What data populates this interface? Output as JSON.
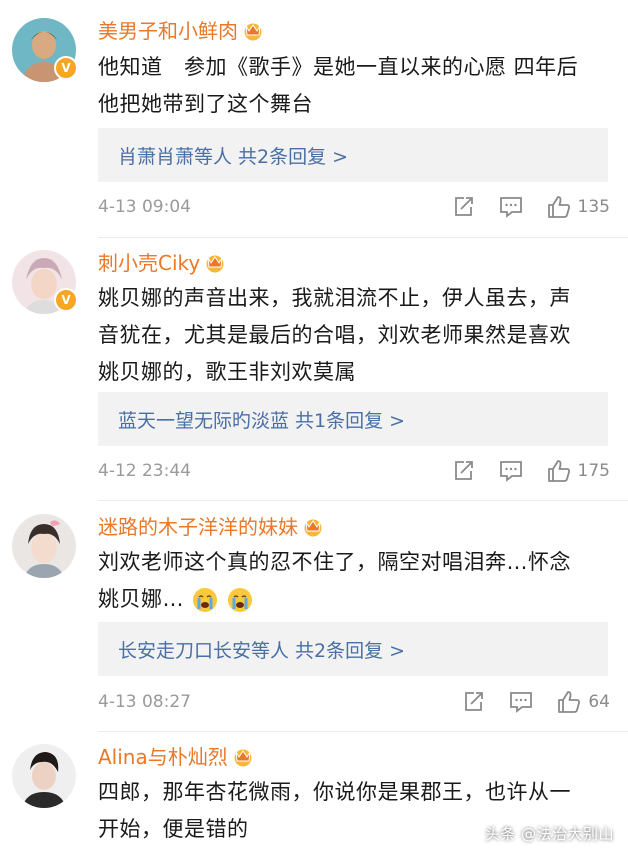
{
  "comments": [
    {
      "username": "美男子和小鲜肉",
      "text_lines": [
        "他知道　参加《歌手》是她一直以来的心愿 四年后",
        "他把她带到了这个舞台"
      ],
      "reply_names": "肖萧肖萧等人",
      "reply_count": "共2条回复 >",
      "time": "4-13 09:04",
      "likes": "135",
      "verified": true
    },
    {
      "username": "刺小壳Ciky",
      "text_lines": [
        "姚贝娜的声音出来，我就泪流不止，伊人虽去，声",
        "音犹在，尤其是最后的合唱，刘欢老师果然是喜欢",
        "姚贝娜的，歌王非刘欢莫属"
      ],
      "reply_names": "蓝天一望无际旳淡蓝",
      "reply_count": "共1条回复 >",
      "time": "4-12 23:44",
      "likes": "175",
      "verified": true
    },
    {
      "username": "迷路的木子洋洋的妹妹",
      "text_lines": [
        "刘欢老师这个真的忍不住了，隔空对唱泪奔…怀念",
        "姚贝娜…"
      ],
      "reply_names": "长安走刀口长安等人",
      "reply_count": "共2条回复 >",
      "time": "4-13 08:27",
      "likes": "64",
      "verified": false
    },
    {
      "username": "Alina与朴灿烈",
      "text_lines": [
        "四郎，那年杏花微雨，你说你是果郡王，也许从一",
        "开始，便是错的"
      ],
      "verified": false
    }
  ],
  "watermark": "头条 @法治大别山",
  "colors": {
    "username": "#e8792b",
    "reply_link": "#4a6fa5",
    "reply_bg": "#f2f2f2",
    "meta": "#9a9a9a",
    "verified_badge": "#f5a623"
  },
  "icons": [
    "share-icon",
    "comment-icon",
    "like-icon",
    "crown-icon",
    "crying-emoji"
  ]
}
